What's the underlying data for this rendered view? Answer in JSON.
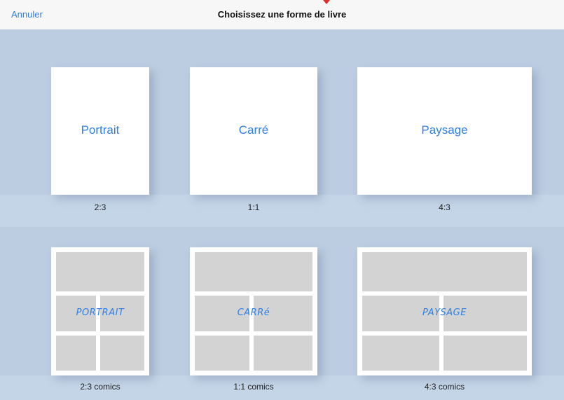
{
  "header": {
    "cancel_label": "Annuler",
    "title": "Choisissez une forme de livre"
  },
  "colors": {
    "accent": "#2f7fe6",
    "background": "#bccde2",
    "panel": "#d3d3d3"
  },
  "formats": [
    {
      "label": "Portrait",
      "ratio": "2:3"
    },
    {
      "label": "Carré",
      "ratio": "1:1"
    },
    {
      "label": "Paysage",
      "ratio": "4:3"
    }
  ],
  "comics": [
    {
      "label": "PORTRAIT",
      "ratio": "2:3 comics"
    },
    {
      "label": "CARRé",
      "ratio": "1:1 comics"
    },
    {
      "label": "PAYSAGE",
      "ratio": "4:3 comics"
    }
  ]
}
